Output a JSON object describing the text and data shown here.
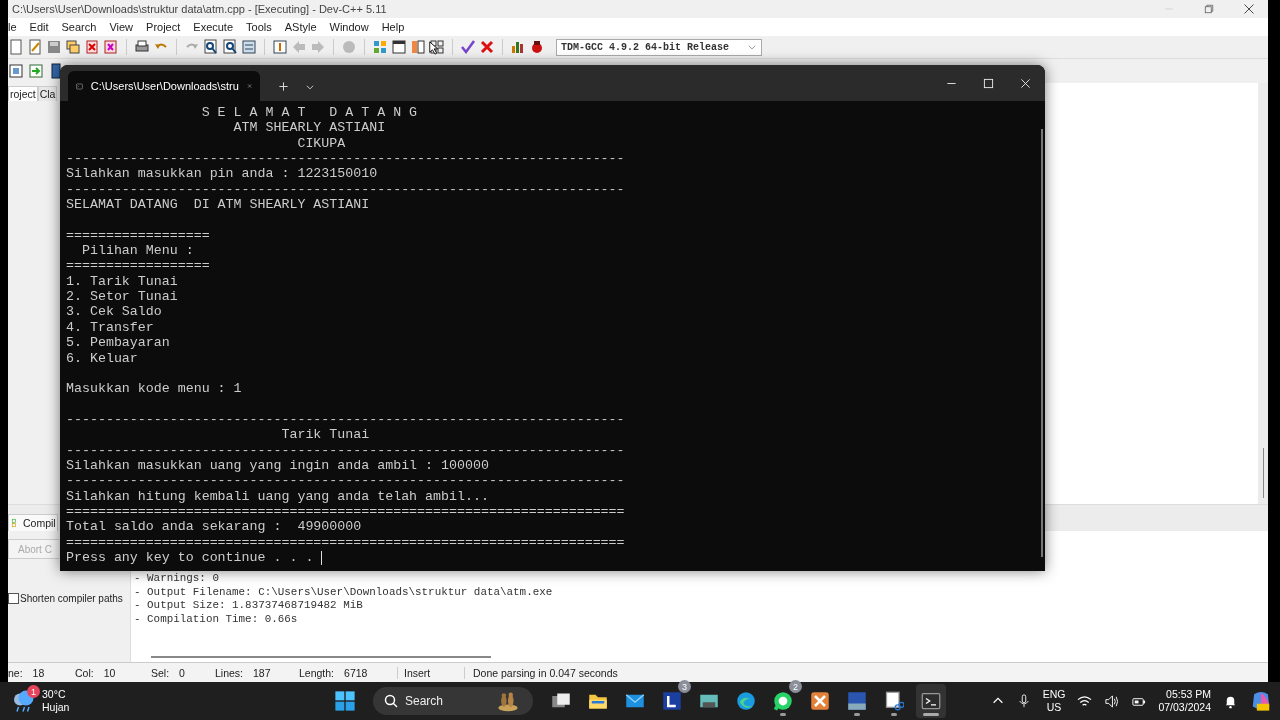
{
  "ide_window": {
    "title": "C:\\Users\\User\\Downloads\\struktur data\\atm.cpp - [Executing] - Dev-C++ 5.11",
    "menu": [
      "le",
      "Edit",
      "Search",
      "View",
      "Project",
      "Execute",
      "Tools",
      "AStyle",
      "Window",
      "Help"
    ],
    "compiler_select": {
      "value": "TDM-GCC 4.9.2 64-bit Release"
    },
    "project_tabs": [
      {
        "label": "roject",
        "selected": true
      },
      {
        "label": "Cla",
        "selected": false
      }
    ],
    "bottom_tabs": [
      {
        "label": "Compil",
        "selected": true
      }
    ],
    "abort_button": {
      "label": "Abort C",
      "disabled": true
    },
    "shorten_paths": {
      "label": "Shorten compiler paths",
      "checked": false
    },
    "compile_log": [
      "- Warnings: 0",
      "- Output Filename: C:\\Users\\User\\Downloads\\struktur data\\atm.exe",
      "- Output Size: 1.83737468719482 MiB",
      "- Compilation Time: 0.66s"
    ],
    "status_bar": {
      "fields": [
        {
          "label": "ne:",
          "value": "18"
        },
        {
          "label": "Col:",
          "value": "10"
        },
        {
          "label": "Sel:",
          "value": "0"
        },
        {
          "label": "Lines:",
          "value": "187"
        },
        {
          "label": "Length:",
          "value": "6718"
        }
      ],
      "mode": "Insert",
      "message": "Done parsing in 0.047 seconds"
    }
  },
  "terminal": {
    "tab_title": "C:\\Users\\User\\Downloads\\stru",
    "cursor": true,
    "lines": [
      {
        "kind": "text",
        "text": "                 S E L A M A T   D A T A N G"
      },
      {
        "kind": "text",
        "text": "                     ATM SHEARLY ASTIANI"
      },
      {
        "kind": "text",
        "text": "                             CIKUPA"
      },
      {
        "kind": "text",
        "text": "----------------------------------------------------------------------"
      },
      {
        "kind": "text",
        "text": "Silahkan masukkan pin anda : 1223150010"
      },
      {
        "kind": "text",
        "text": "----------------------------------------------------------------------"
      },
      {
        "kind": "text",
        "text": "SELAMAT DATANG  DI ATM SHEARLY ASTIANI"
      },
      {
        "kind": "blank"
      },
      {
        "kind": "text",
        "text": "=================="
      },
      {
        "kind": "text",
        "text": "  Pilihan Menu :"
      },
      {
        "kind": "text",
        "text": "=================="
      },
      {
        "kind": "text",
        "text": "1. Tarik Tunai"
      },
      {
        "kind": "text",
        "text": "2. Setor Tunai"
      },
      {
        "kind": "text",
        "text": "3. Cek Saldo"
      },
      {
        "kind": "text",
        "text": "4. Transfer"
      },
      {
        "kind": "text",
        "text": "5. Pembayaran"
      },
      {
        "kind": "text",
        "text": "6. Keluar"
      },
      {
        "kind": "blank"
      },
      {
        "kind": "text",
        "text": "Masukkan kode menu : 1"
      },
      {
        "kind": "blank"
      },
      {
        "kind": "text",
        "text": "----------------------------------------------------------------------"
      },
      {
        "kind": "text",
        "text": "                           Tarik Tunai"
      },
      {
        "kind": "text",
        "text": "----------------------------------------------------------------------"
      },
      {
        "kind": "text",
        "text": "Silahkan masukkan uang yang ingin anda ambil : 100000"
      },
      {
        "kind": "text",
        "text": "----------------------------------------------------------------------"
      },
      {
        "kind": "text",
        "text": "Silahkan hitung kembali uang yang anda telah ambil..."
      },
      {
        "kind": "text",
        "text": "======================================================================"
      },
      {
        "kind": "text",
        "text": "Total saldo anda sekarang :  49900000"
      },
      {
        "kind": "text",
        "text": "======================================================================"
      },
      {
        "kind": "text",
        "text": "Press any key to continue . . . "
      }
    ]
  },
  "taskbar": {
    "weather": {
      "badge": "1",
      "temperature": "30°C",
      "condition": "Hujan"
    },
    "search": {
      "placeholder": "Search"
    },
    "apps": [
      {
        "kind": "taskview",
        "running": false,
        "active": false
      },
      {
        "kind": "explorer",
        "running": false,
        "active": false
      },
      {
        "kind": "mail",
        "running": false,
        "active": false
      },
      {
        "kind": "letter-app",
        "badge": "3",
        "running": false,
        "active": false
      },
      {
        "kind": "keyboard-app",
        "running": false,
        "active": false
      },
      {
        "kind": "edge",
        "running": false,
        "active": false
      },
      {
        "kind": "whatsapp",
        "badge": "2",
        "running": true,
        "active": false
      },
      {
        "kind": "xampp",
        "running": false,
        "active": false
      },
      {
        "kind": "devcpp",
        "running": true,
        "active": false
      },
      {
        "kind": "snipping",
        "running": true,
        "active": false
      },
      {
        "kind": "terminal",
        "running": true,
        "active": true
      }
    ],
    "language": {
      "code": "ENG",
      "region": "US"
    },
    "time": "05:53 PM",
    "date": "07/03/2024"
  }
}
